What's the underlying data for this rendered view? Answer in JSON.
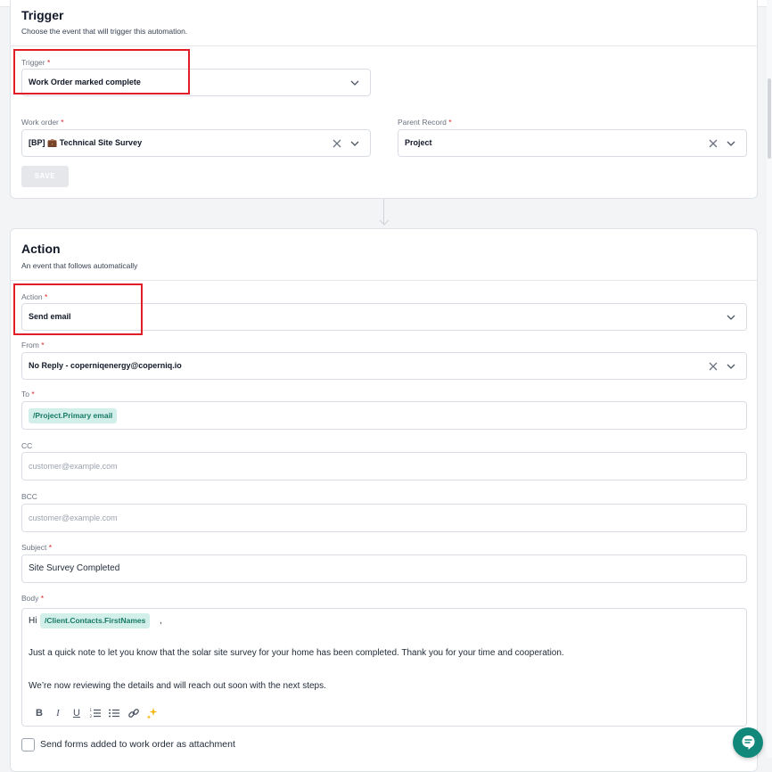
{
  "trigger_section": {
    "title": "Trigger",
    "subtitle": "Choose the event that will trigger this automation.",
    "trigger_field": {
      "label": "Trigger",
      "required_mark": "*",
      "value": "Work Order marked complete"
    },
    "work_order_field": {
      "label": "Work order",
      "required_mark": "*",
      "value": "[BP] 💼 Technical Site Survey"
    },
    "parent_record_field": {
      "label": "Parent Record",
      "required_mark": "*",
      "value": "Project"
    },
    "save_label": "SAVE"
  },
  "action_section": {
    "title": "Action",
    "subtitle": "An event that follows automatically",
    "action_field": {
      "label": "Action",
      "required_mark": "*",
      "value": "Send email"
    },
    "from_field": {
      "label": "From",
      "required_mark": "*",
      "value": "No Reply - coperniqenergy@coperniq.io"
    },
    "to_field": {
      "label": "To",
      "required_mark": "*",
      "token": "/Project.Primary email"
    },
    "cc_field": {
      "label": "CC",
      "placeholder": "customer@example.com"
    },
    "bcc_field": {
      "label": "BCC",
      "placeholder": "customer@example.com"
    },
    "subject_field": {
      "label": "Subject",
      "required_mark": "*",
      "value": "Site Survey Completed"
    },
    "body_field": {
      "label": "Body",
      "required_mark": "*",
      "greeting": "Hi",
      "token": "/Client.Contacts.FirstNames",
      "greeting_suffix": ",",
      "paragraph_1": "Just a quick note to let you know that the solar site survey for your home has been completed. Thank you for your time and cooperation.",
      "paragraph_2": "We’re now reviewing the details and will reach out soon with the next steps.",
      "toolbar": {
        "bold": "B",
        "italic": "I",
        "underline": "U",
        "ordered_list_icon": "ordered-list-icon",
        "bullet_list_icon": "bullet-list-icon",
        "link_icon": "link-icon",
        "ai_icon": "sparkle-icon"
      }
    },
    "attachment_checkbox": {
      "label": "Send forms added to work order as attachment",
      "checked": false
    }
  },
  "colors": {
    "accent": "#12887a",
    "token_bg": "#d3efe9",
    "token_text": "#167a66",
    "required": "#dc2626",
    "highlight": "#e11d27"
  }
}
